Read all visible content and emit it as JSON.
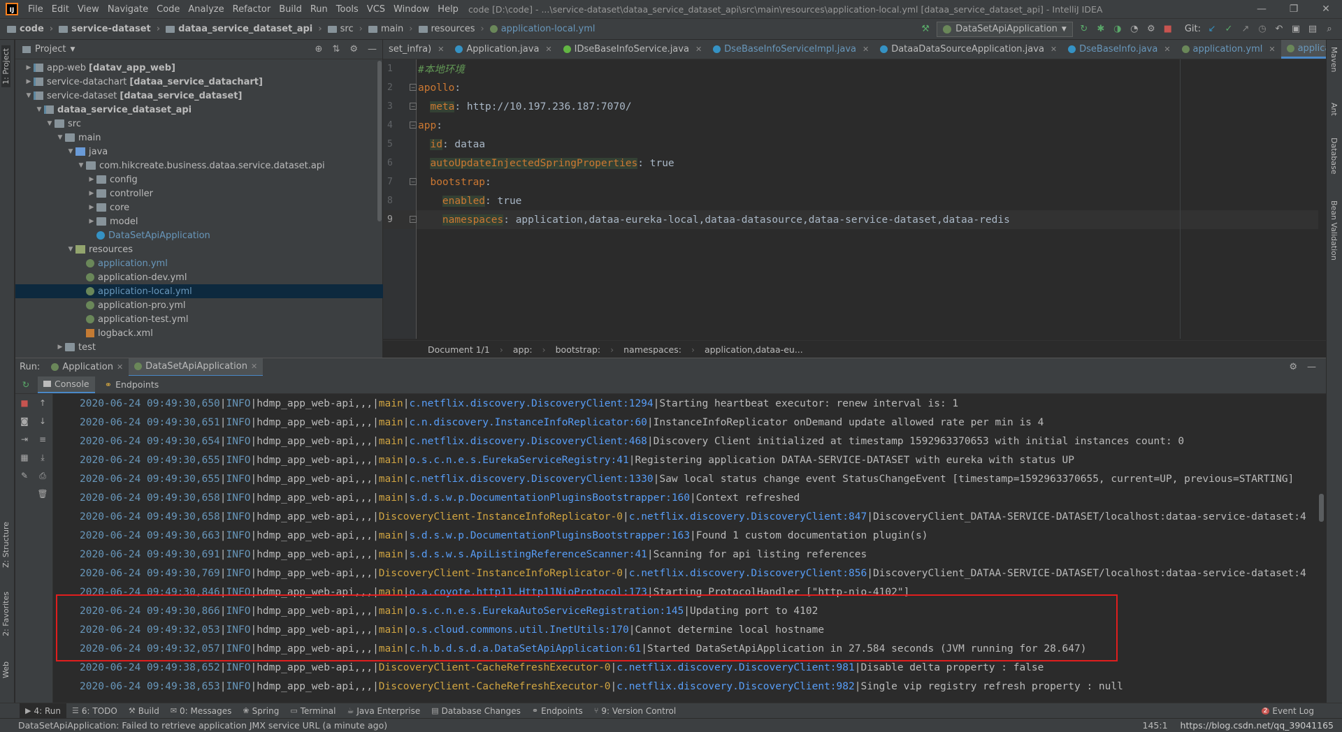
{
  "menubar": {
    "items": [
      "File",
      "Edit",
      "View",
      "Navigate",
      "Code",
      "Analyze",
      "Refactor",
      "Build",
      "Run",
      "Tools",
      "VCS",
      "Window",
      "Help"
    ],
    "window_title": "code [D:\\code] - ...\\service-dataset\\dataa_service_dataset_api\\src\\main\\resources\\application-local.yml [dataa_service_dataset_api] - IntelliJ IDEA"
  },
  "navbar": {
    "crumbs": [
      "code",
      "service-dataset",
      "dataa_service_dataset_api",
      "src",
      "main",
      "resources",
      "application-local.yml"
    ],
    "run_config": "DataSetApiApplication",
    "git_label": "Git:"
  },
  "left_strip": {
    "project": "1: Project",
    "structure": "Z: Structure",
    "favorites": "2: Favorites",
    "web": "Web"
  },
  "right_strip": {
    "maven": "Maven",
    "ant": "Ant",
    "database": "Database",
    "bean": "Bean Validation"
  },
  "project": {
    "title": "Project",
    "tree": [
      {
        "label": "app-web",
        "bold": "[datav_app_web]",
        "depth": 0,
        "arrow": "▶",
        "icon": "mod"
      },
      {
        "label": "service-datachart",
        "bold": "[dataa_service_datachart]",
        "depth": 0,
        "arrow": "▶",
        "icon": "mod"
      },
      {
        "label": "service-dataset",
        "bold": "[dataa_service_dataset]",
        "depth": 0,
        "arrow": "▼",
        "icon": "mod"
      },
      {
        "label": "dataa_service_dataset_api",
        "bold": "",
        "depth": 1,
        "arrow": "▼",
        "icon": "mod",
        "strong": true
      },
      {
        "label": "src",
        "bold": "",
        "depth": 2,
        "arrow": "▼",
        "icon": "folder"
      },
      {
        "label": "main",
        "bold": "",
        "depth": 3,
        "arrow": "▼",
        "icon": "folder"
      },
      {
        "label": "java",
        "bold": "",
        "depth": 4,
        "arrow": "▼",
        "icon": "src"
      },
      {
        "label": "com.hikcreate.business.dataa.service.dataset.api",
        "bold": "",
        "depth": 5,
        "arrow": "▼",
        "icon": "pkg"
      },
      {
        "label": "config",
        "bold": "",
        "depth": 6,
        "arrow": "▶",
        "icon": "pkg"
      },
      {
        "label": "controller",
        "bold": "",
        "depth": 6,
        "arrow": "▶",
        "icon": "pkg"
      },
      {
        "label": "core",
        "bold": "",
        "depth": 6,
        "arrow": "▶",
        "icon": "pkg"
      },
      {
        "label": "model",
        "bold": "",
        "depth": 6,
        "arrow": "▶",
        "icon": "pkg"
      },
      {
        "label": "DataSetApiApplication",
        "bold": "",
        "depth": 6,
        "arrow": "",
        "icon": "cls",
        "blue": true
      },
      {
        "label": "resources",
        "bold": "",
        "depth": 4,
        "arrow": "▼",
        "icon": "res"
      },
      {
        "label": "application.yml",
        "bold": "",
        "depth": 5,
        "arrow": "",
        "icon": "yml",
        "blue": true
      },
      {
        "label": "application-dev.yml",
        "bold": "",
        "depth": 5,
        "arrow": "",
        "icon": "yml"
      },
      {
        "label": "application-local.yml",
        "bold": "",
        "depth": 5,
        "arrow": "",
        "icon": "yml",
        "selected": true,
        "blue": true
      },
      {
        "label": "application-pro.yml",
        "bold": "",
        "depth": 5,
        "arrow": "",
        "icon": "yml"
      },
      {
        "label": "application-test.yml",
        "bold": "",
        "depth": 5,
        "arrow": "",
        "icon": "yml"
      },
      {
        "label": "logback.xml",
        "bold": "",
        "depth": 5,
        "arrow": "",
        "icon": "xml"
      },
      {
        "label": "test",
        "bold": "",
        "depth": 3,
        "arrow": "▶",
        "icon": "folder"
      }
    ]
  },
  "editor": {
    "tabs": [
      {
        "label": "set_infra)",
        "icon": "",
        "active": false
      },
      {
        "label": "Application.java",
        "icon": "#3592c4",
        "active": false
      },
      {
        "label": "IDseBaseInfoService.java",
        "icon": "#62b543",
        "active": false
      },
      {
        "label": "DseBaseInfoServiceImpl.java",
        "icon": "#3592c4",
        "active": false,
        "blue": true
      },
      {
        "label": "DataaDataSourceApplication.java",
        "icon": "#3592c4",
        "active": false
      },
      {
        "label": "DseBaseInfo.java",
        "icon": "#3592c4",
        "active": false,
        "blue": true
      },
      {
        "label": "application.yml",
        "icon": "#6a8759",
        "active": false,
        "blue": true
      },
      {
        "label": "application-local.yml",
        "icon": "#6a8759",
        "active": true,
        "blue": true
      }
    ],
    "lines": [
      {
        "num": "1",
        "parts": [
          {
            "t": "#本地环境",
            "c": "g"
          }
        ]
      },
      {
        "num": "2",
        "parts": [
          {
            "t": "apollo",
            "c": "k"
          },
          {
            "t": ":",
            "c": "v"
          }
        ],
        "fold": true
      },
      {
        "num": "3",
        "parts": [
          {
            "t": "  ",
            "c": "v"
          },
          {
            "t": "meta",
            "c": "kh"
          },
          {
            "t": ": http://10.197.236.187:7070/",
            "c": "v"
          }
        ],
        "fold": true
      },
      {
        "num": "4",
        "parts": [
          {
            "t": "app",
            "c": "k"
          },
          {
            "t": ":",
            "c": "v"
          }
        ],
        "fold": true
      },
      {
        "num": "5",
        "parts": [
          {
            "t": "  ",
            "c": "v"
          },
          {
            "t": "id",
            "c": "kh"
          },
          {
            "t": ": dataa",
            "c": "v"
          }
        ]
      },
      {
        "num": "6",
        "parts": [
          {
            "t": "  ",
            "c": "v"
          },
          {
            "t": "autoUpdateInjectedSpringProperties",
            "c": "kh"
          },
          {
            "t": ": true",
            "c": "v"
          }
        ]
      },
      {
        "num": "7",
        "parts": [
          {
            "t": "  ",
            "c": "v"
          },
          {
            "t": "bootstrap",
            "c": "k"
          },
          {
            "t": ":",
            "c": "v"
          }
        ],
        "fold": true
      },
      {
        "num": "8",
        "parts": [
          {
            "t": "    ",
            "c": "v"
          },
          {
            "t": "enabled",
            "c": "kh"
          },
          {
            "t": ": true",
            "c": "v"
          }
        ]
      },
      {
        "num": "9",
        "parts": [
          {
            "t": "    ",
            "c": "v"
          },
          {
            "t": "namespaces",
            "c": "kh"
          },
          {
            "t": ": application,dataa-eureka-local,dataa-datasource,dataa-service-dataset,dataa-redis",
            "c": "v"
          }
        ],
        "fold": true,
        "current": true
      }
    ],
    "breadcrumb": [
      "Document 1/1",
      "app:",
      "bootstrap:",
      "namespaces:",
      "application,dataa-eu..."
    ]
  },
  "run": {
    "label": "Run:",
    "tabs": [
      {
        "label": "Application",
        "active": false
      },
      {
        "label": "DataSetApiApplication",
        "active": true
      }
    ],
    "subtabs": [
      "Console",
      "Endpoints"
    ],
    "log": [
      {
        "ts": "2020-06-24 09:49:30,650",
        "lv": "INFO",
        "app": "hdmp_app_web-api,,,",
        "th": "main",
        "cls": "c.netflix.discovery.DiscoveryClient:1294",
        "msg": "Starting heartbeat executor: renew interval is: 1"
      },
      {
        "ts": "2020-06-24 09:49:30,651",
        "lv": "INFO",
        "app": "hdmp_app_web-api,,,",
        "th": "main",
        "cls": "c.n.discovery.InstanceInfoReplicator:60",
        "msg": "InstanceInfoReplicator onDemand update allowed rate per min is 4"
      },
      {
        "ts": "2020-06-24 09:49:30,654",
        "lv": "INFO",
        "app": "hdmp_app_web-api,,,",
        "th": "main",
        "cls": "c.netflix.discovery.DiscoveryClient:468",
        "msg": "Discovery Client initialized at timestamp 1592963370653 with initial instances count: 0"
      },
      {
        "ts": "2020-06-24 09:49:30,655",
        "lv": "INFO",
        "app": "hdmp_app_web-api,,,",
        "th": "main",
        "cls": "o.s.c.n.e.s.EurekaServiceRegistry:41",
        "msg": "Registering application DATAA-SERVICE-DATASET with eureka with status UP"
      },
      {
        "ts": "2020-06-24 09:49:30,655",
        "lv": "INFO",
        "app": "hdmp_app_web-api,,,",
        "th": "main",
        "cls": "c.netflix.discovery.DiscoveryClient:1330",
        "msg": "Saw local status change event StatusChangeEvent [timestamp=1592963370655, current=UP, previous=STARTING]"
      },
      {
        "ts": "2020-06-24 09:49:30,658",
        "lv": "INFO",
        "app": "hdmp_app_web-api,,,",
        "th": "main",
        "cls": "s.d.s.w.p.DocumentationPluginsBootstrapper:160",
        "msg": "Context refreshed"
      },
      {
        "ts": "2020-06-24 09:49:30,658",
        "lv": "INFO",
        "app": "hdmp_app_web-api,,,",
        "th": "DiscoveryClient-InstanceInfoReplicator-0",
        "cls": "c.netflix.discovery.DiscoveryClient:847",
        "msg": "DiscoveryClient_DATAA-SERVICE-DATASET/localhost:dataa-service-dataset:4"
      },
      {
        "ts": "2020-06-24 09:49:30,663",
        "lv": "INFO",
        "app": "hdmp_app_web-api,,,",
        "th": "main",
        "cls": "s.d.s.w.p.DocumentationPluginsBootstrapper:163",
        "msg": "Found 1 custom documentation plugin(s)"
      },
      {
        "ts": "2020-06-24 09:49:30,691",
        "lv": "INFO",
        "app": "hdmp_app_web-api,,,",
        "th": "main",
        "cls": "s.d.s.w.s.ApiListingReferenceScanner:41",
        "msg": "Scanning for api listing references"
      },
      {
        "ts": "2020-06-24 09:49:30,769",
        "lv": "INFO",
        "app": "hdmp_app_web-api,,,",
        "th": "DiscoveryClient-InstanceInfoReplicator-0",
        "cls": "c.netflix.discovery.DiscoveryClient:856",
        "msg": "DiscoveryClient_DATAA-SERVICE-DATASET/localhost:dataa-service-dataset:4"
      },
      {
        "ts": "2020-06-24 09:49:30,846",
        "lv": "INFO",
        "app": "hdmp_app_web-api,,,",
        "th": "main",
        "cls": "o.a.coyote.http11.Http11NioProtocol:173",
        "msg": "Starting ProtocolHandler [\"http-nio-4102\"]"
      },
      {
        "ts": "2020-06-24 09:49:30,866",
        "lv": "INFO",
        "app": "hdmp_app_web-api,,,",
        "th": "main",
        "cls": "o.s.c.n.e.s.EurekaAutoServiceRegistration:145",
        "msg": "Updating port to 4102"
      },
      {
        "ts": "2020-06-24 09:49:32,053",
        "lv": "INFO",
        "app": "hdmp_app_web-api,,,",
        "th": "main",
        "cls": "o.s.cloud.commons.util.InetUtils:170",
        "msg": "Cannot determine local hostname"
      },
      {
        "ts": "2020-06-24 09:49:32,057",
        "lv": "INFO",
        "app": "hdmp_app_web-api,,,",
        "th": "main",
        "cls": "c.h.b.d.s.d.a.DataSetApiApplication:61",
        "msg": "Started DataSetApiApplication in 27.584 seconds (JVM running for 28.647)"
      },
      {
        "ts": "2020-06-24 09:49:38,652",
        "lv": "INFO",
        "app": "hdmp_app_web-api,,,",
        "th": "DiscoveryClient-CacheRefreshExecutor-0",
        "cls": "c.netflix.discovery.DiscoveryClient:981",
        "msg": "Disable delta property : false"
      },
      {
        "ts": "2020-06-24 09:49:38,653",
        "lv": "INFO",
        "app": "hdmp_app_web-api,,,",
        "th": "DiscoveryClient-CacheRefreshExecutor-0",
        "cls": "c.netflix.discovery.DiscoveryClient:982",
        "msg": "Single vip registry refresh property : null"
      }
    ]
  },
  "bottombar": {
    "items": [
      "4: Run",
      "6: TODO",
      "Build",
      "0: Messages",
      "Spring",
      "Terminal",
      "Java Enterprise",
      "Database Changes",
      "Endpoints",
      "9: Version Control"
    ],
    "event_log": "Event Log",
    "event_count": "2"
  },
  "statusbar": {
    "message": "DataSetApiApplication: Failed to retrieve application JMX service URL (a minute ago)",
    "position": "145:1",
    "watermark": "https://blog.csdn.net/qq_39041165"
  }
}
